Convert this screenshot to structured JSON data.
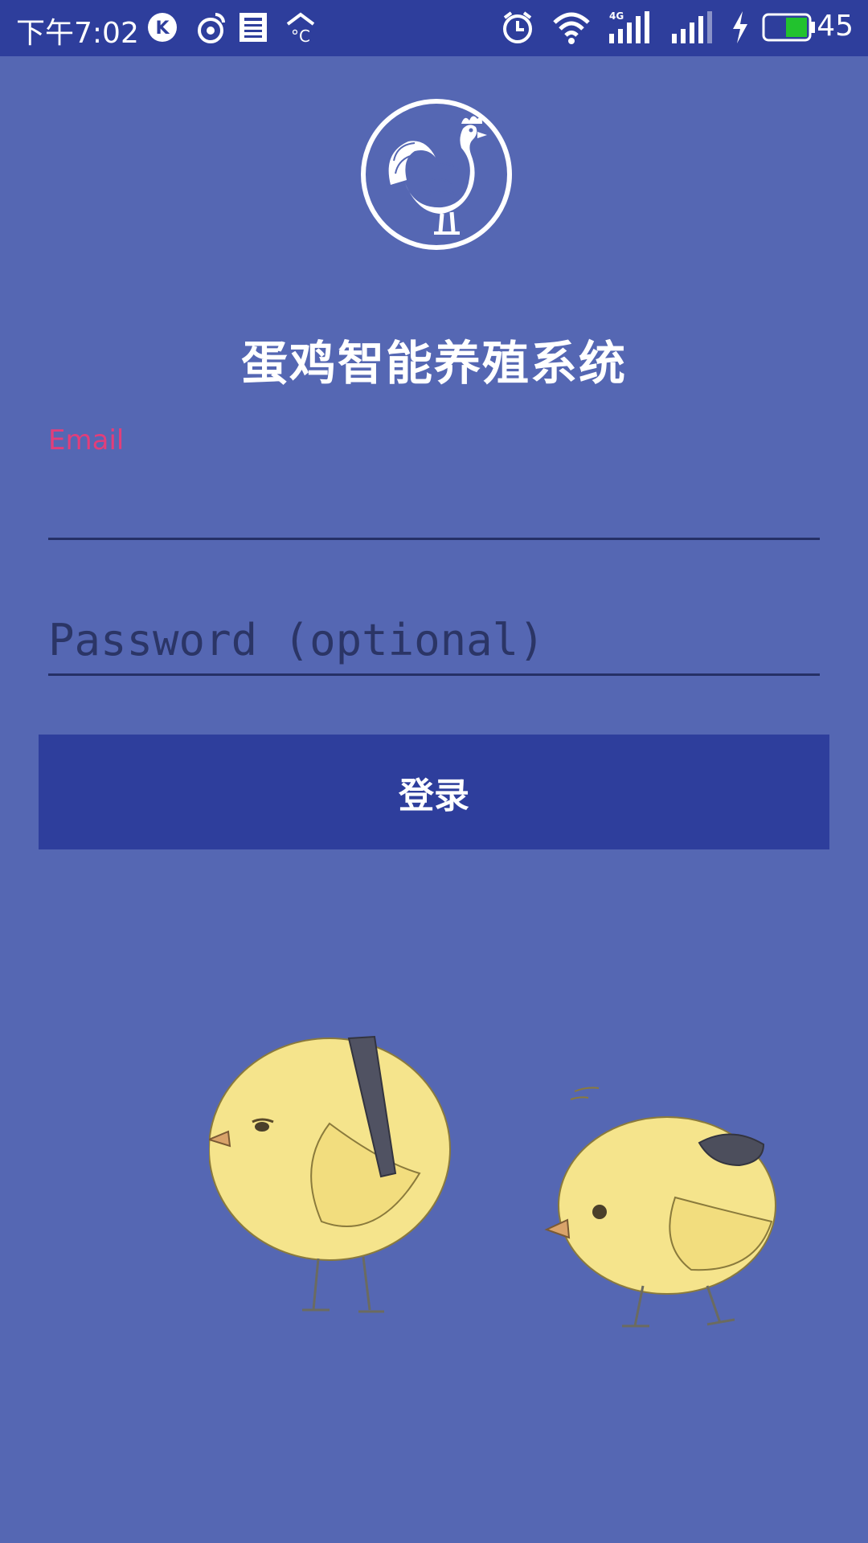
{
  "status_bar": {
    "time": "下午7:02",
    "battery": "45",
    "icons": [
      "k-app-icon",
      "weibo-icon",
      "news-icon",
      "weather-icon",
      "alarm-icon",
      "wifi-icon",
      "signal-4g-icon",
      "signal-icon",
      "charging-icon",
      "battery-icon"
    ]
  },
  "app": {
    "title": "蛋鸡智能养殖系统",
    "logo": "rooster-logo-icon"
  },
  "form": {
    "email_label": "Email",
    "email_value": "",
    "password_placeholder": "Password (optional)",
    "login_label": "登录"
  },
  "colors": {
    "background": "#5567b3",
    "primary": "#2e3e9c",
    "accent": "#e23e7a"
  },
  "illustration": "two-chicks-illustration"
}
